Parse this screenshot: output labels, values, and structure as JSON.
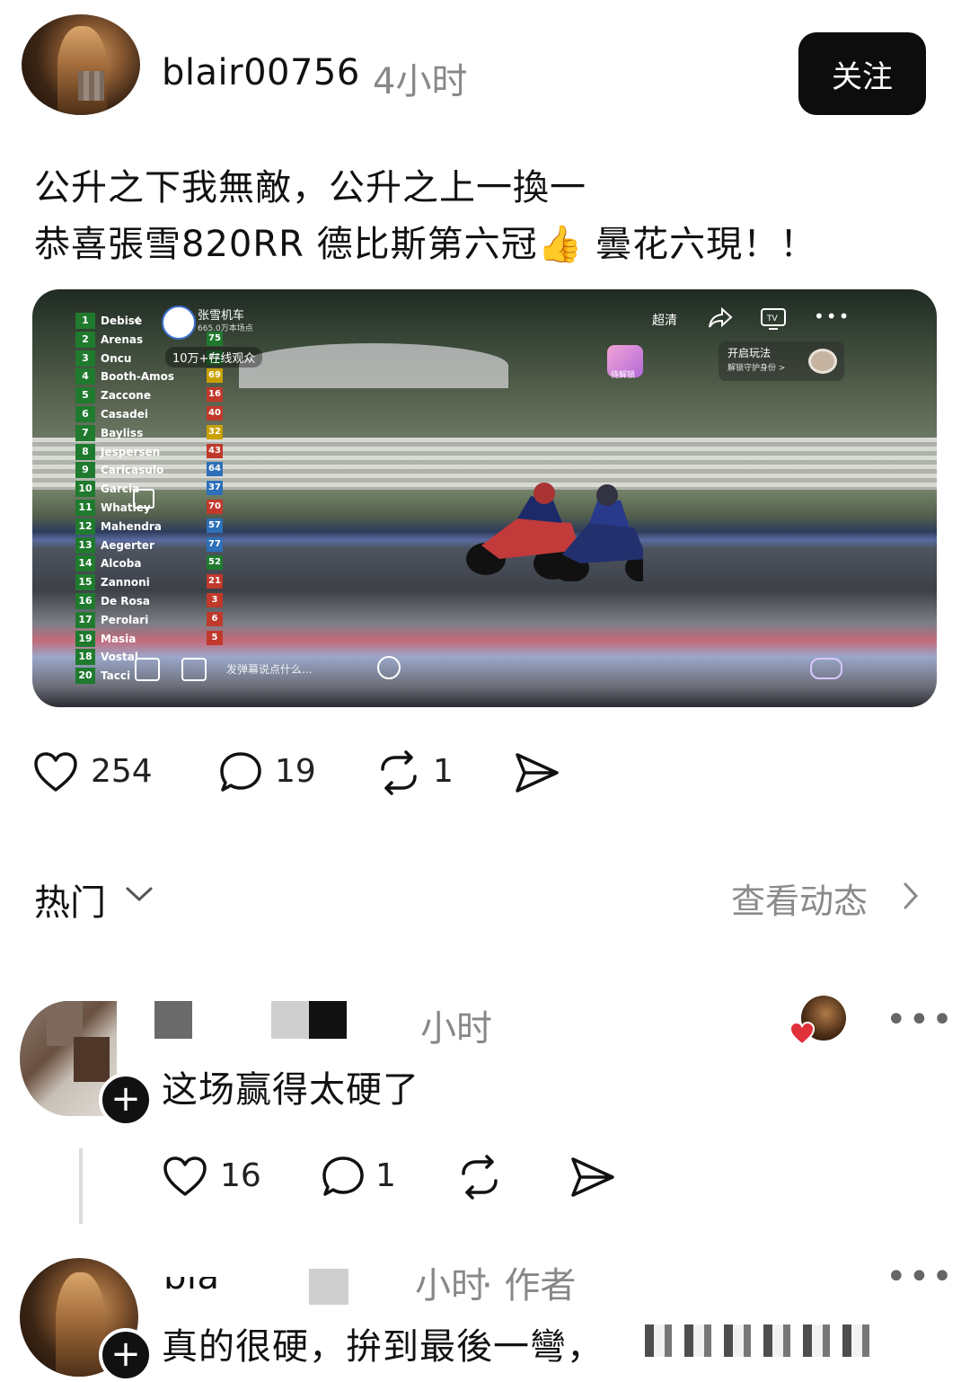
{
  "post": {
    "username": "blair00756",
    "time": "4小时",
    "follow_label": "关注",
    "text_line1": "公升之下我無敵，公升之上一換一",
    "text_line2": "恭喜張雪820RR 德比斯第六冠👍 曇花六現！！",
    "likes": "254",
    "comments": "19",
    "reposts": "1"
  },
  "video": {
    "channel_name": "张雪机车",
    "channel_stats": "665.0万本场点",
    "viewers": "10万+在线观众",
    "quality_label": "超清",
    "play_label": "开启玩法",
    "play_sub": "解锁守护身份 >",
    "gift_label": "待解锁",
    "input_placeholder": "发弹幕说点什么...",
    "leaderboard": [
      {
        "pos": "1",
        "name": "Debise",
        "val": ""
      },
      {
        "pos": "2",
        "name": "Arenas",
        "val": "75"
      },
      {
        "pos": "3",
        "name": "Oncu",
        "val": "61"
      },
      {
        "pos": "4",
        "name": "Booth-Amos",
        "val": "69"
      },
      {
        "pos": "5",
        "name": "Zaccone",
        "val": "16"
      },
      {
        "pos": "6",
        "name": "Casadei",
        "val": "40"
      },
      {
        "pos": "7",
        "name": "Bayliss",
        "val": "32"
      },
      {
        "pos": "8",
        "name": "Jespersen",
        "val": "43"
      },
      {
        "pos": "9",
        "name": "Caricasulo",
        "val": "64"
      },
      {
        "pos": "10",
        "name": "Garcia",
        "val": "37"
      },
      {
        "pos": "11",
        "name": "Whatley",
        "val": "70"
      },
      {
        "pos": "12",
        "name": "Mahendra",
        "val": "57"
      },
      {
        "pos": "13",
        "name": "Aegerter",
        "val": "77"
      },
      {
        "pos": "14",
        "name": "Alcoba",
        "val": "52"
      },
      {
        "pos": "15",
        "name": "Zannoni",
        "val": "21"
      },
      {
        "pos": "16",
        "name": "De Rosa",
        "val": "3"
      },
      {
        "pos": "17",
        "name": "Perolari",
        "val": "6"
      },
      {
        "pos": "19",
        "name": "Masia",
        "val": "5"
      },
      {
        "pos": "18",
        "name": "Vostal",
        "val": ""
      },
      {
        "pos": "20",
        "name": "Tacci",
        "val": ""
      }
    ],
    "value_colors": [
      "#1f7a2e",
      "#1f7a2e",
      "#1f7a2e",
      "#c9a000",
      "#c0392b",
      "#c0392b",
      "#c9a000",
      "#c0392b",
      "#2d6fb8",
      "#2d6fb8",
      "#c0392b",
      "#2d6fb8",
      "#2d6fb8",
      "#1f7a2e",
      "#c0392b",
      "#c0392b",
      "#c0392b",
      "#c0392b",
      "#1f7a2e",
      "#1f7a2e"
    ]
  },
  "feed": {
    "section_label": "热门",
    "view_activity": "查看动态"
  },
  "comments": [
    {
      "time": "小时",
      "text": "这场赢得太硬了",
      "likes": "16",
      "replies": "1"
    },
    {
      "username_partial": "bla",
      "time": "小时",
      "author_tag": "· 作者",
      "text": "真的很硬，拚到最後一彎，"
    }
  ],
  "colors": {
    "heart_badge": "#e0303a",
    "follow_bg": "#0d0d0d",
    "muted_text": "#888888"
  }
}
